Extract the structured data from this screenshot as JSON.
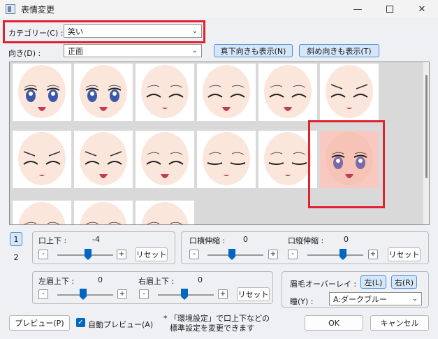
{
  "window": {
    "title": "表情変更"
  },
  "category": {
    "label": "カテゴリー(C) :",
    "value": "笑い"
  },
  "direction": {
    "label": "向き(D) :",
    "value": "正面"
  },
  "buttons": {
    "show_straight_down": "真下向きも表示(N)",
    "show_diagonal": "斜め向きも表示(T)",
    "reset": "リセット",
    "preview": "プレビュー(P)",
    "ok": "OK",
    "cancel": "キャンセル",
    "left": "左(L)",
    "right": "右(R)"
  },
  "pages": [
    "1",
    "2"
  ],
  "sliders": {
    "mouth_updown": {
      "label": "口上下 :",
      "value": "-4"
    },
    "mouth_width": {
      "label": "口横伸縮 :",
      "value": "0"
    },
    "mouth_height": {
      "label": "口縦伸縮 :",
      "value": "0"
    },
    "left_brow": {
      "label": "左眉上下 :",
      "value": "0"
    },
    "right_brow": {
      "label": "右眉上下 :",
      "value": "0"
    }
  },
  "stepper": {
    "minus": "-",
    "plus": "+"
  },
  "eyebrow_overlay": {
    "label": "眉毛オーバーレイ :"
  },
  "pupil": {
    "label": "瞳(Y) :",
    "value": "A:ダークブルー"
  },
  "auto_preview": {
    "label": "自動プレビュー(A)",
    "checked": true
  },
  "note": {
    "line1": "* 「環境設定」で口上下などの",
    "line2": "標準設定を変更できます"
  },
  "gallery": {
    "rows": [
      [
        "open-blue",
        "open-blue-smile",
        "closed-smile",
        "closed-smile-open",
        "closed-laugh",
        "closed-frown"
      ],
      [
        "closed-frown",
        "closed-frown-laugh",
        "closed-tongue",
        "relaxed-closed",
        "relaxed-closed-small",
        "open-purple-selected"
      ],
      [
        "partial",
        "partial",
        "partial"
      ]
    ]
  }
}
